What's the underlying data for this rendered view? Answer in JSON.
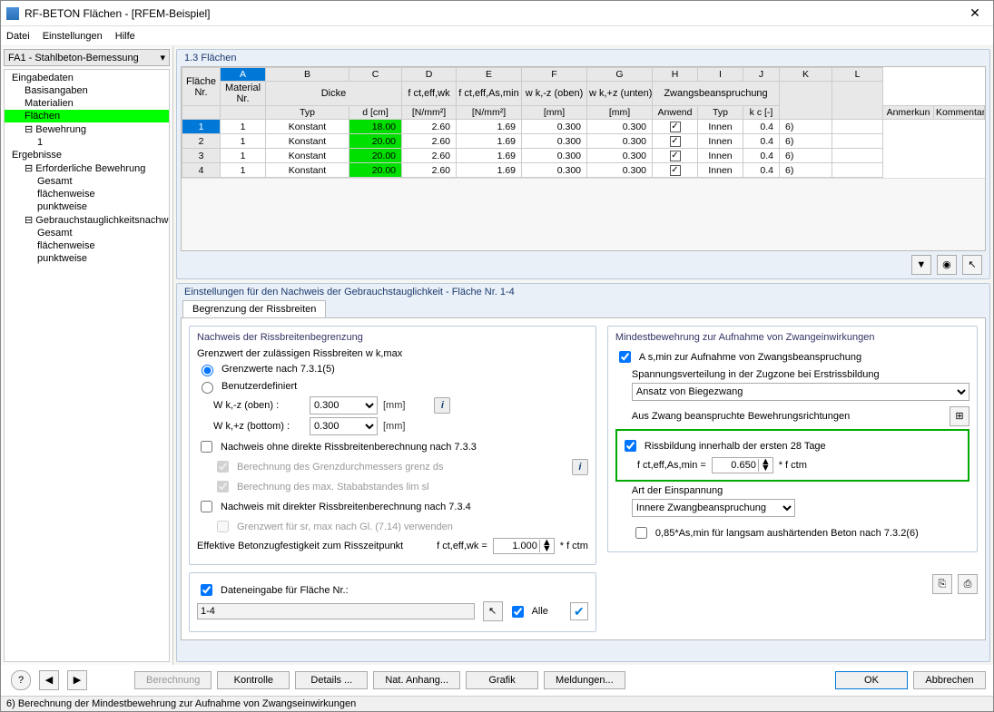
{
  "window": {
    "title": "RF-BETON Flächen - [RFEM-Beispiel]"
  },
  "menu": {
    "file": "Datei",
    "settings": "Einstellungen",
    "help": "Hilfe"
  },
  "combo_case": "FA1 - Stahlbeton-Bemessung",
  "tree": {
    "input": "Eingabedaten",
    "basis": "Basisangaben",
    "materials": "Materialien",
    "flaechen": "Flächen",
    "bewehrung": "Bewehrung",
    "beweh_1": "1",
    "results": "Ergebnisse",
    "erf": "Erforderliche Bewehrung",
    "gesamt": "Gesamt",
    "flaechenweise": "flächenweise",
    "punktweise": "punktweise",
    "gzg": "Gebrauchstauglichkeitsnachweis",
    "gesamt2": "Gesamt",
    "flaechenweise2": "flächenweise",
    "punktweise2": "punktweise"
  },
  "main_header": "1.3 Flächen",
  "cols": {
    "A": "A",
    "B": "B",
    "C": "C",
    "D": "D",
    "E": "E",
    "F": "F",
    "G": "G",
    "H": "H",
    "I": "I",
    "J": "J",
    "K": "K",
    "L": "L",
    "flaeche": "Fläche",
    "nr": "Nr.",
    "mat": "Material",
    "dicke": "Dicke",
    "typ": "Typ",
    "d": "d [cm]",
    "fctwk": "f ct,eff,wk",
    "fctwkU": "[N/mm²]",
    "fctmin": "f ct,eff,As,min",
    "fctminU": "[N/mm²]",
    "wkoben": "w k,-z (oben)",
    "wkobenU": "[mm]",
    "wkunten": "w k,+z (unten)",
    "wkuntenU": "[mm]",
    "zwang": "Zwangsbeanspruchung",
    "anwend": "Anwend",
    "typ2": "Typ",
    "kc": "k c [-]",
    "anmerk": "Anmerkun",
    "kommentar": "Kommentar"
  },
  "rows": [
    {
      "nr": "1",
      "mat": "1",
      "typ": "Konstant",
      "d": "18.00",
      "fwk": "2.60",
      "fmin": "1.69",
      "wkob": "0.300",
      "wkun": "0.300",
      "anw": true,
      "ztyp": "Innen",
      "kc": "0.4",
      "ank": "6)",
      "kom": ""
    },
    {
      "nr": "2",
      "mat": "1",
      "typ": "Konstant",
      "d": "20.00",
      "fwk": "2.60",
      "fmin": "1.69",
      "wkob": "0.300",
      "wkun": "0.300",
      "anw": true,
      "ztyp": "Innen",
      "kc": "0.4",
      "ank": "6)",
      "kom": ""
    },
    {
      "nr": "3",
      "mat": "1",
      "typ": "Konstant",
      "d": "20.00",
      "fwk": "2.60",
      "fmin": "1.69",
      "wkob": "0.300",
      "wkun": "0.300",
      "anw": true,
      "ztyp": "Innen",
      "kc": "0.4",
      "ank": "6)",
      "kom": ""
    },
    {
      "nr": "4",
      "mat": "1",
      "typ": "Konstant",
      "d": "20.00",
      "fwk": "2.60",
      "fmin": "1.69",
      "wkob": "0.300",
      "wkun": "0.300",
      "anw": true,
      "ztyp": "Innen",
      "kc": "0.4",
      "ank": "6)",
      "kom": ""
    }
  ],
  "settings_header": "Einstellungen für den Nachweis der Gebrauchstauglichkeit - Fläche Nr. 1-4",
  "tab_label": "Begrenzung der Rissbreiten",
  "left": {
    "group_title": "Nachweis der Rissbreitenbegrenzung",
    "grenzwert_label": "Grenzwert der zulässigen Rissbreiten w k,max",
    "opt_731_5": "Grenzwerte nach 7.3.1(5)",
    "opt_benutzer": "Benutzerdefiniert",
    "wk_oben_lbl": "W k,-z (oben) :",
    "wk_oben_val": "0.300",
    "wk_bot_lbl": "W k,+z (bottom) :",
    "wk_bot_val": "0.300",
    "mm": "[mm]",
    "ohne_direkte": "Nachweis ohne direkte Rissbreitenberechnung nach 7.3.3",
    "grenzds": "Berechnung des Grenzdurchmessers  grenz ds",
    "maxstab": "Berechnung des max. Stababstandes lim sl",
    "mit_direkte": "Nachweis mit direkter Rissbreitenberechnung nach 7.3.4",
    "sr_max": "Grenzwert für sr, max nach Gl. (7.14) verwenden",
    "eff_betonzug": "Effektive Betonzugfestigkeit zum Risszeitpunkt",
    "fctwk_lbl": "f ct,eff,wk =",
    "fctwk_val": "1.000",
    "fctm_mult": "* f ctm"
  },
  "right": {
    "group_title": "Mindestbewehrung zur Aufnahme von Zwangeinwirkungen",
    "asmin_chk": "A s,min zur Aufnahme von Zwangsbeanspruchung",
    "spannung_lbl": "Spannungsverteilung in der Zugzone bei Erstrissbildung",
    "spannung_sel": "Ansatz von Biegezwang",
    "auszwang_lbl": "Aus Zwang beanspruchte Bewehrungsrichtungen",
    "riss28": "Rissbildung innerhalb der ersten 28 Tage",
    "fctmin_lbl": "f ct,eff,As,min =",
    "fctmin_val": "0.650",
    "fctm_mult": "* f ctm",
    "art_lbl": "Art der Einspannung",
    "art_sel": "Innere Zwangbeanspruchung",
    "langsam": "0,85*As,min für langsam aushärtenden Beton nach 7.3.2(6)"
  },
  "bottom_group": {
    "daten_chk": "Dateneingabe für Fläche Nr.:",
    "range_val": "1-4",
    "alle": "Alle"
  },
  "buttons": {
    "berechnung": "Berechnung",
    "kontrolle": "Kontrolle",
    "details": "Details ...",
    "nat_anhang": "Nat. Anhang...",
    "grafik": "Grafik",
    "meldungen": "Meldungen...",
    "ok": "OK",
    "abbrechen": "Abbrechen"
  },
  "status": "6) Berechnung der Mindestbewehrung zur Aufnahme von Zwangseinwirkungen"
}
